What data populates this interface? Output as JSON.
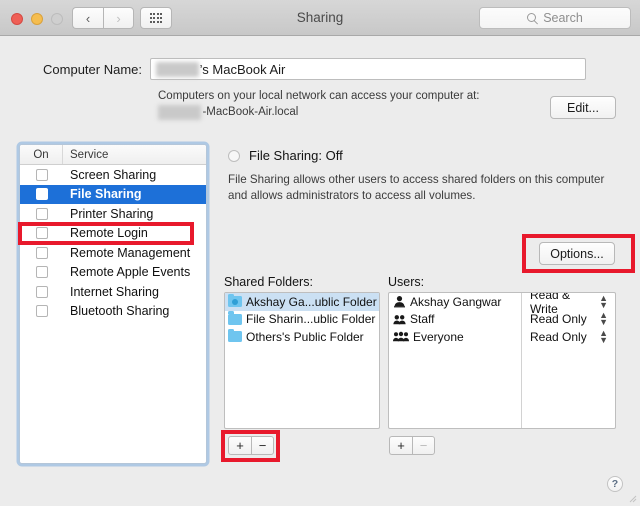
{
  "window": {
    "title": "Sharing",
    "traffic_lights": [
      "close",
      "minimize",
      "zoom"
    ]
  },
  "toolbar": {
    "back_glyph": "‹",
    "forward_glyph": "›",
    "grid_icon": "show-all-icon",
    "search": {
      "placeholder": "Search",
      "value": "",
      "icon": "search-icon"
    }
  },
  "computer_name": {
    "label": "Computer Name:",
    "redacted_prefix": "Akshay",
    "value_suffix": "’s MacBook Air",
    "hostname_line1": "Computers on your local network can access your computer at:",
    "hostname_redacted_prefix": "Akshays",
    "hostname_suffix": "-MacBook-Air.local",
    "edit_label": "Edit..."
  },
  "services": {
    "header_on": "On",
    "header_service": "Service",
    "items": [
      {
        "label": "Screen Sharing",
        "on": false,
        "selected": false
      },
      {
        "label": "File Sharing",
        "on": false,
        "selected": true
      },
      {
        "label": "Printer Sharing",
        "on": false,
        "selected": false
      },
      {
        "label": "Remote Login",
        "on": false,
        "selected": false
      },
      {
        "label": "Remote Management",
        "on": false,
        "selected": false
      },
      {
        "label": "Remote Apple Events",
        "on": false,
        "selected": false
      },
      {
        "label": "Internet Sharing",
        "on": false,
        "selected": false
      },
      {
        "label": "Bluetooth Sharing",
        "on": false,
        "selected": false
      }
    ]
  },
  "detail": {
    "status_label": "File Sharing: Off",
    "status_checked": false,
    "description": "File Sharing allows other users to access shared folders on this computer and allows administrators to access all volumes.",
    "options_label": "Options...",
    "shared_folders_heading": "Shared Folders:",
    "users_heading": "Users:",
    "shared_folders": [
      {
        "label": "Akshay Ga...ublic Folder",
        "icon": "home-folder-icon",
        "selected": true
      },
      {
        "label": "File Sharin...ublic Folder",
        "icon": "folder-icon",
        "selected": false
      },
      {
        "label": "Others's Public Folder",
        "icon": "folder-icon",
        "selected": false
      }
    ],
    "users": [
      {
        "name": "Akshay Gangwar",
        "icon": "single-person-icon",
        "permission": "Read & Write"
      },
      {
        "name": "Staff",
        "icon": "two-people-icon",
        "permission": "Read Only"
      },
      {
        "name": "Everyone",
        "icon": "three-people-icon",
        "permission": "Read Only"
      }
    ],
    "folders_add_label": "+",
    "folders_remove_label": "−",
    "users_add_label": "+",
    "users_remove_label": "−"
  },
  "help": {
    "label": "?"
  },
  "annotations": {
    "color": "#E8192C",
    "boxes": [
      "file-sharing-row",
      "options-button",
      "shared-folders-add-remove"
    ]
  }
}
